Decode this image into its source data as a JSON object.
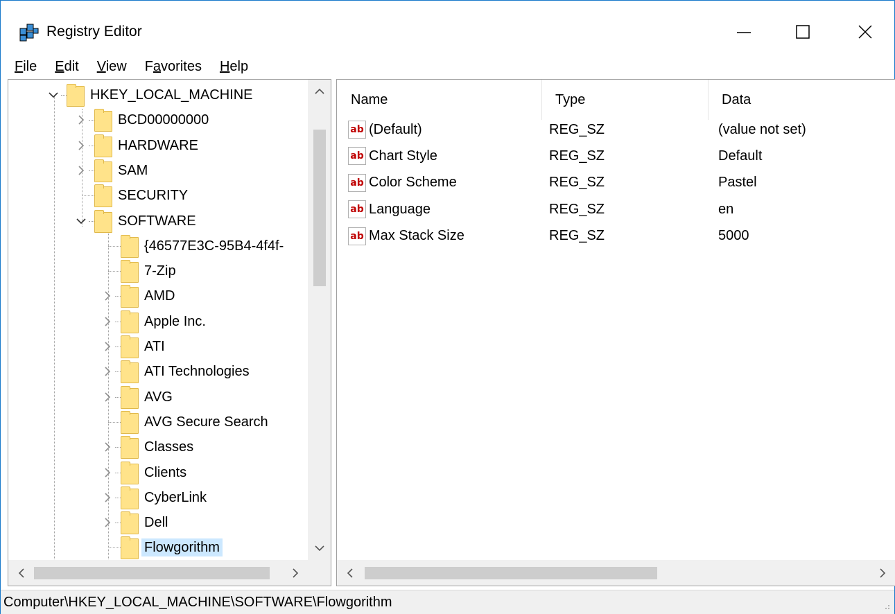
{
  "window": {
    "title": "Registry Editor",
    "controls": {
      "minimize": "minimize-icon",
      "maximize": "maximize-icon",
      "close": "close-icon"
    }
  },
  "menu": {
    "items": [
      {
        "label": "File",
        "accel": "F",
        "rest": "ile"
      },
      {
        "label": "Edit",
        "accel": "E",
        "rest": "dit"
      },
      {
        "label": "View",
        "accel": "V",
        "rest": "iew"
      },
      {
        "label": "Favorites",
        "accel": "a",
        "pre": "F",
        "rest": "vorites"
      },
      {
        "label": "Help",
        "accel": "H",
        "rest": "elp"
      }
    ]
  },
  "tree": {
    "items": [
      {
        "label": "HKEY_LOCAL_MACHINE",
        "expanded": true,
        "level": 0
      },
      {
        "label": "BCD00000000",
        "expanded": false,
        "level": 1
      },
      {
        "label": "HARDWARE",
        "expanded": false,
        "level": 1
      },
      {
        "label": "SAM",
        "expanded": false,
        "level": 1
      },
      {
        "label": "SECURITY",
        "leaf": true,
        "level": 1
      },
      {
        "label": "SOFTWARE",
        "expanded": true,
        "level": 1
      },
      {
        "label": "{46577E3C-95B4-4f4f-",
        "leaf": true,
        "level": 2
      },
      {
        "label": "7-Zip",
        "leaf": true,
        "level": 2
      },
      {
        "label": "AMD",
        "expanded": false,
        "level": 2
      },
      {
        "label": "Apple Inc.",
        "expanded": false,
        "level": 2
      },
      {
        "label": "ATI",
        "expanded": false,
        "level": 2
      },
      {
        "label": "ATI Technologies",
        "expanded": false,
        "level": 2
      },
      {
        "label": "AVG",
        "expanded": false,
        "level": 2
      },
      {
        "label": "AVG Secure Search",
        "leaf": true,
        "level": 2
      },
      {
        "label": "Classes",
        "expanded": false,
        "level": 2
      },
      {
        "label": "Clients",
        "expanded": false,
        "level": 2
      },
      {
        "label": "CyberLink",
        "expanded": false,
        "level": 2
      },
      {
        "label": "Dell",
        "expanded": false,
        "level": 2
      },
      {
        "label": "Flowgorithm",
        "leaf": true,
        "level": 2,
        "selected": true
      }
    ]
  },
  "list": {
    "columns": [
      "Name",
      "Type",
      "Data"
    ],
    "rows": [
      {
        "icon": "ab",
        "name": "(Default)",
        "type": "REG_SZ",
        "data": "(value not set)"
      },
      {
        "icon": "ab",
        "name": "Chart Style",
        "type": "REG_SZ",
        "data": "Default"
      },
      {
        "icon": "ab",
        "name": "Color Scheme",
        "type": "REG_SZ",
        "data": "Pastel"
      },
      {
        "icon": "ab",
        "name": "Language",
        "type": "REG_SZ",
        "data": "en"
      },
      {
        "icon": "ab",
        "name": "Max Stack Size",
        "type": "REG_SZ",
        "data": "5000"
      }
    ]
  },
  "status": {
    "path": "Computer\\HKEY_LOCAL_MACHINE\\SOFTWARE\\Flowgorithm"
  },
  "colors": {
    "selection": "#cce8ff",
    "folder": "#ffe38a",
    "border": "#1979ca"
  }
}
